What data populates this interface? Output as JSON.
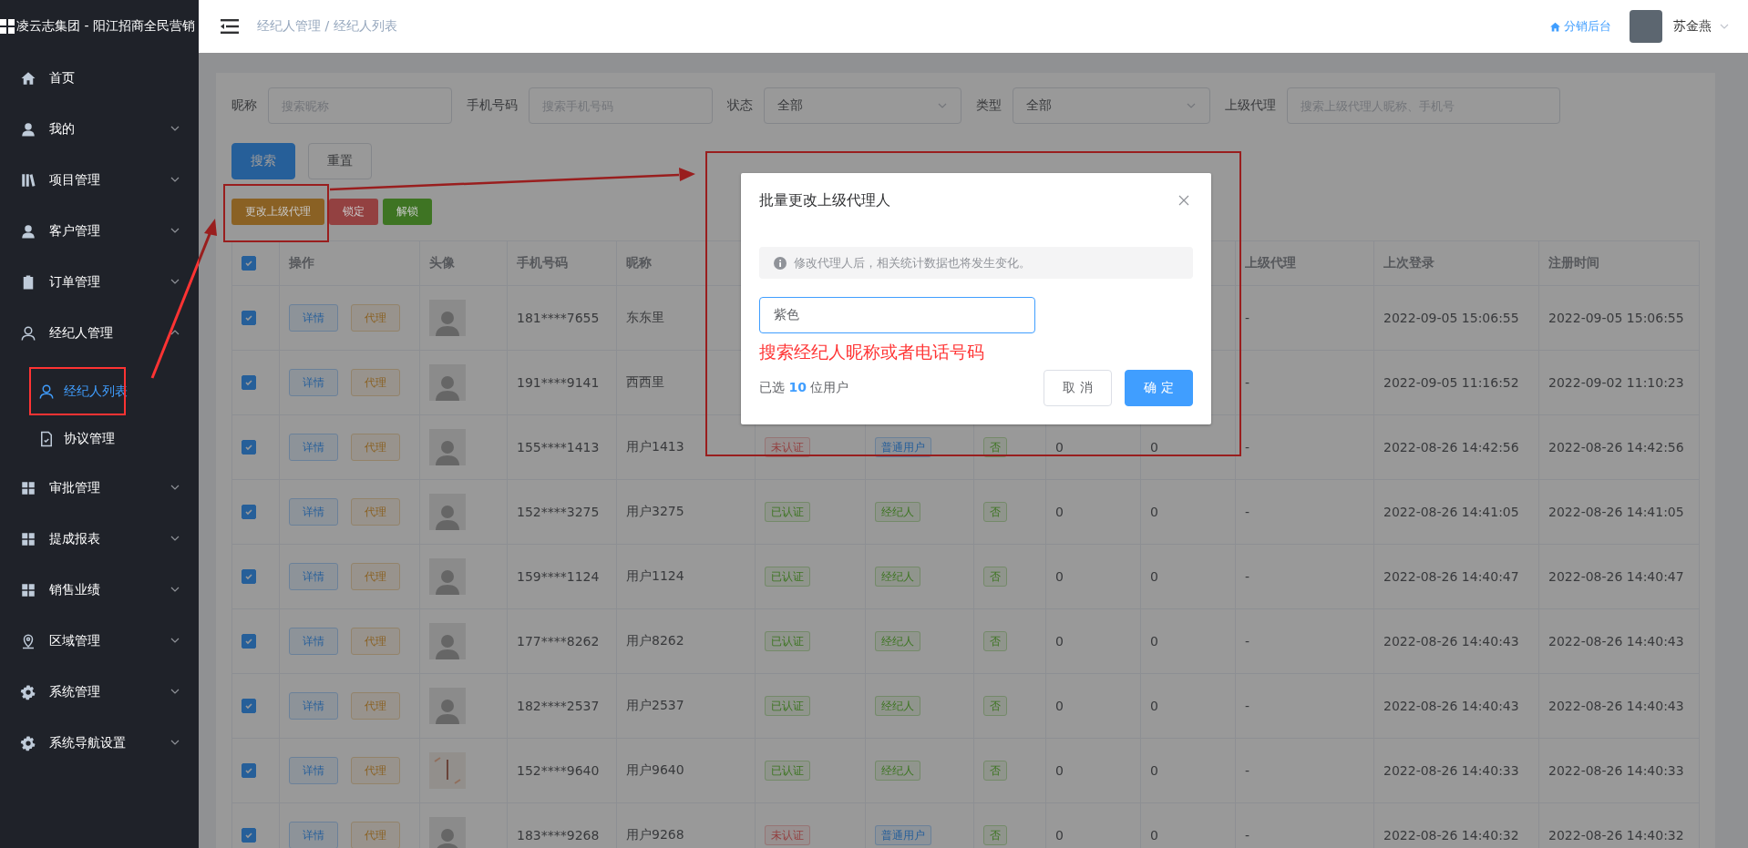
{
  "brand": {
    "title": "凌云志集团 - 阳江招商全民营销"
  },
  "sidebar": {
    "items": [
      {
        "label": "首页",
        "kind": "link"
      },
      {
        "label": "我的",
        "kind": "menu",
        "expanded": false
      },
      {
        "label": "项目管理",
        "kind": "menu",
        "expanded": false
      },
      {
        "label": "客户管理",
        "kind": "menu",
        "expanded": false
      },
      {
        "label": "订单管理",
        "kind": "menu",
        "expanded": false
      },
      {
        "label": "经纪人管理",
        "kind": "menu",
        "expanded": true,
        "children": [
          {
            "label": "经纪人列表",
            "selected": true
          },
          {
            "label": "协议管理",
            "selected": false
          }
        ]
      },
      {
        "label": "审批管理",
        "kind": "menu",
        "expanded": false
      },
      {
        "label": "提成报表",
        "kind": "menu",
        "expanded": false
      },
      {
        "label": "销售业绩",
        "kind": "menu",
        "expanded": false
      },
      {
        "label": "区域管理",
        "kind": "menu",
        "expanded": false
      },
      {
        "label": "系统管理",
        "kind": "menu",
        "expanded": false
      },
      {
        "label": "系统导航设置",
        "kind": "menu",
        "expanded": false
      }
    ]
  },
  "header": {
    "breadcrumb": "经纪人管理 / 经纪人列表",
    "link": "分销后台",
    "user": "苏金燕"
  },
  "filters": [
    {
      "label": "昵称",
      "kind": "input",
      "placeholder": "搜索昵称"
    },
    {
      "label": "手机号码",
      "kind": "input",
      "placeholder": "搜索手机号码"
    },
    {
      "label": "状态",
      "kind": "select",
      "value": "全部"
    },
    {
      "label": "类型",
      "kind": "select",
      "value": "全部"
    },
    {
      "label": "上级代理",
      "kind": "input",
      "placeholder": "搜索上级代理人昵称、手机号"
    }
  ],
  "search_buttons": [
    "搜索",
    "重置"
  ],
  "action_buttons": [
    {
      "label": "更改上级代理",
      "color": "#8a6124"
    },
    {
      "label": "锁定",
      "color": "#934141"
    },
    {
      "label": "解锁",
      "color": "#3e7423"
    }
  ],
  "table": {
    "all_checked": true,
    "columns": [
      {
        "label": "操作"
      },
      {
        "label": "头像"
      },
      {
        "label": "手机号码"
      },
      {
        "label": "昵称"
      },
      {},
      {},
      {},
      {},
      {},
      {
        "label": "上级代理"
      },
      {
        "label": "上次登录"
      },
      {
        "label": "注册时间"
      }
    ],
    "rows": [
      {
        "checked": true,
        "actions": [
          "详情",
          "代理"
        ],
        "has_photo": false,
        "phone": "181****7655",
        "nickname": "东东里",
        "parent_agent": "-",
        "last_login": "2022-09-05 15:06:55",
        "registered": "2022-09-05 15:06:55"
      },
      {
        "checked": true,
        "actions": [
          "详情",
          "代理"
        ],
        "has_photo": false,
        "phone": "191****9141",
        "nickname": "西西里",
        "parent_agent": "-",
        "last_login": "2022-09-05 11:16:52",
        "registered": "2022-09-02 11:10:23"
      },
      {
        "checked": true,
        "actions": [
          "详情",
          "代理"
        ],
        "has_photo": false,
        "phone": "155****1413",
        "nickname": "用户1413",
        "status": {
          "label": "未认证",
          "verified": false
        },
        "type": {
          "label": "普通用户",
          "kind": "user"
        },
        "flag": "否",
        "count_1": "0",
        "count_2": "0",
        "parent_agent": "-",
        "last_login": "2022-08-26 14:42:56",
        "registered": "2022-08-26 14:42:56"
      },
      {
        "checked": true,
        "actions": [
          "详情",
          "代理"
        ],
        "has_photo": false,
        "phone": "152****3275",
        "nickname": "用户3275",
        "status": {
          "label": "已认证",
          "verified": true
        },
        "type": {
          "label": "经纪人",
          "kind": "agent"
        },
        "flag": "否",
        "count_1": "0",
        "count_2": "0",
        "parent_agent": "-",
        "last_login": "2022-08-26 14:41:05",
        "registered": "2022-08-26 14:41:05"
      },
      {
        "checked": true,
        "actions": [
          "详情",
          "代理"
        ],
        "has_photo": false,
        "phone": "159****1124",
        "nickname": "用户1124",
        "status": {
          "label": "已认证",
          "verified": true
        },
        "type": {
          "label": "经纪人",
          "kind": "agent"
        },
        "flag": "否",
        "count_1": "0",
        "count_2": "0",
        "parent_agent": "-",
        "last_login": "2022-08-26 14:40:47",
        "registered": "2022-08-26 14:40:47"
      },
      {
        "checked": true,
        "actions": [
          "详情",
          "代理"
        ],
        "has_photo": false,
        "phone": "177****8262",
        "nickname": "用户8262",
        "status": {
          "label": "已认证",
          "verified": true
        },
        "type": {
          "label": "经纪人",
          "kind": "agent"
        },
        "flag": "否",
        "count_1": "0",
        "count_2": "0",
        "parent_agent": "-",
        "last_login": "2022-08-26 14:40:43",
        "registered": "2022-08-26 14:40:43"
      },
      {
        "checked": true,
        "actions": [
          "详情",
          "代理"
        ],
        "has_photo": false,
        "phone": "182****2537",
        "nickname": "用户2537",
        "status": {
          "label": "已认证",
          "verified": true
        },
        "type": {
          "label": "经纪人",
          "kind": "agent"
        },
        "flag": "否",
        "count_1": "0",
        "count_2": "0",
        "parent_agent": "-",
        "last_login": "2022-08-26 14:40:43",
        "registered": "2022-08-26 14:40:43"
      },
      {
        "checked": true,
        "actions": [
          "详情",
          "代理"
        ],
        "has_photo": true,
        "phone": "152****9640",
        "nickname": "用户9640",
        "status": {
          "label": "已认证",
          "verified": true
        },
        "type": {
          "label": "经纪人",
          "kind": "agent"
        },
        "flag": "否",
        "count_1": "0",
        "count_2": "0",
        "parent_agent": "-",
        "last_login": "2022-08-26 14:40:33",
        "registered": "2022-08-26 14:40:33"
      },
      {
        "checked": true,
        "actions": [
          "详情",
          "代理"
        ],
        "has_photo": false,
        "phone": "183****9268",
        "nickname": "用户9268",
        "status": {
          "label": "未认证",
          "verified": false
        },
        "type": {
          "label": "普通用户",
          "kind": "user"
        },
        "flag": "否",
        "count_1": "0",
        "count_2": "0",
        "parent_agent": "-",
        "last_login": "2022-08-26 14:40:32",
        "registered": "2022-08-26 14:40:32"
      }
    ]
  },
  "dialog": {
    "title": "批量更改上级代理人",
    "notice": "修改代理人后，相关统计数据也将发生变化。",
    "value": "紫色",
    "annotation": "搜索经纪人昵称或者电话号码",
    "selected_count": "已选 **10** 位用户",
    "buttons": [
      "取 消",
      "确 定"
    ]
  }
}
